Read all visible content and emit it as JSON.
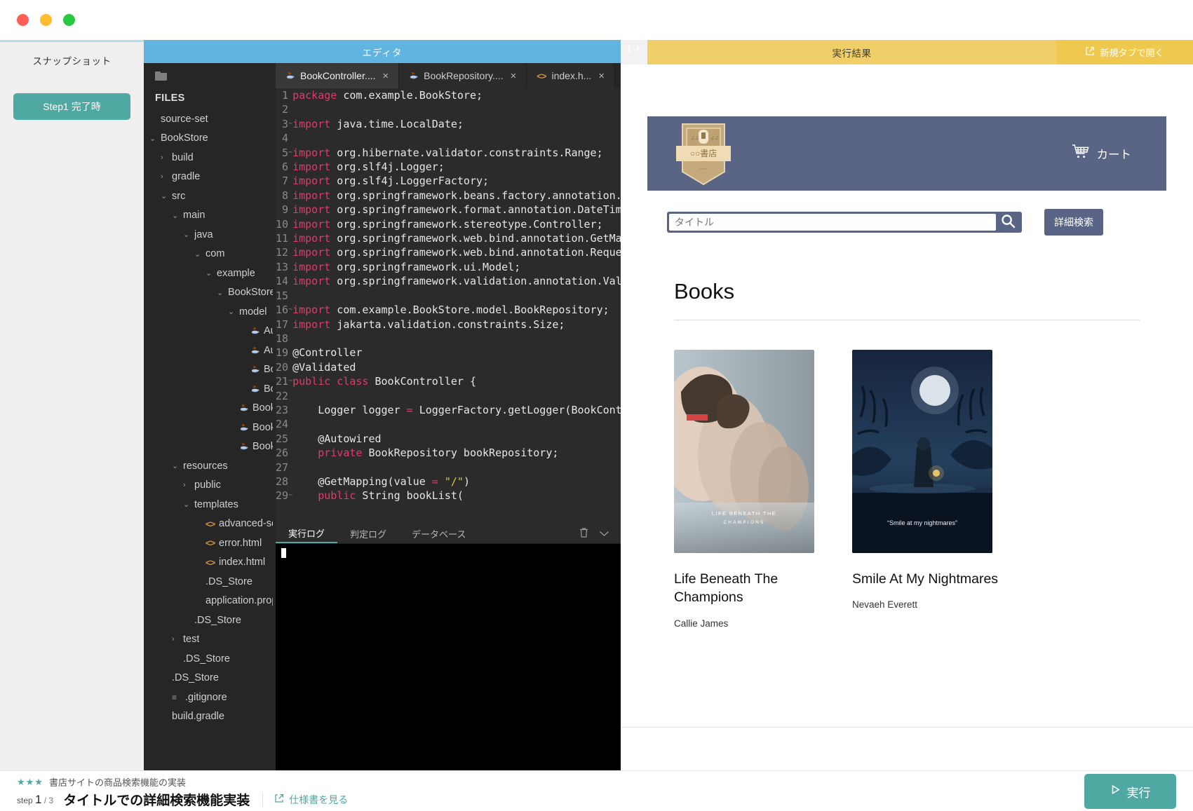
{
  "window": {
    "traffic_lights": [
      "close",
      "minimize",
      "zoom"
    ]
  },
  "snapshot": {
    "title": "スナップショット",
    "button_label": "Step1 完了時"
  },
  "editor": {
    "header_title": "エディタ",
    "filetree_label": "FILES",
    "folder_icon": "folder-icon",
    "items": [
      {
        "label": "source-set",
        "depth": 0,
        "caret": "",
        "icon": ""
      },
      {
        "label": "BookStore",
        "depth": 0,
        "caret": "v",
        "icon": ""
      },
      {
        "label": "build",
        "depth": 1,
        "caret": ">",
        "icon": ""
      },
      {
        "label": "gradle",
        "depth": 1,
        "caret": ">",
        "icon": ""
      },
      {
        "label": "src",
        "depth": 1,
        "caret": "v",
        "icon": ""
      },
      {
        "label": "main",
        "depth": 2,
        "caret": "v",
        "icon": ""
      },
      {
        "label": "java",
        "depth": 3,
        "caret": "v",
        "icon": ""
      },
      {
        "label": "com",
        "depth": 4,
        "caret": "v",
        "icon": ""
      },
      {
        "label": "example",
        "depth": 5,
        "caret": "v",
        "icon": ""
      },
      {
        "label": "BookStore",
        "depth": 6,
        "caret": "v",
        "icon": ""
      },
      {
        "label": "model",
        "depth": 7,
        "caret": "v",
        "icon": ""
      },
      {
        "label": "Author.java",
        "depth": 8,
        "caret": "",
        "icon": "java"
      },
      {
        "label": "AuthorRepository.java",
        "depth": 8,
        "caret": "",
        "icon": "java"
      },
      {
        "label": "Book.java",
        "depth": 8,
        "caret": "",
        "icon": "java"
      },
      {
        "label": "BookRepository.java",
        "depth": 8,
        "caret": "",
        "icon": "java"
      },
      {
        "label": "BookController.java",
        "depth": 7,
        "caret": "",
        "icon": "java"
      },
      {
        "label": "BookStoreApplication.java",
        "depth": 7,
        "caret": "",
        "icon": "java"
      },
      {
        "label": "BookStoreController.java",
        "depth": 7,
        "caret": "",
        "icon": "java"
      },
      {
        "label": "resources",
        "depth": 2,
        "caret": "v",
        "icon": ""
      },
      {
        "label": "public",
        "depth": 3,
        "caret": ">",
        "icon": ""
      },
      {
        "label": "templates",
        "depth": 3,
        "caret": "v",
        "icon": ""
      },
      {
        "label": "advanced-search.html",
        "depth": 4,
        "caret": "",
        "icon": "html"
      },
      {
        "label": "error.html",
        "depth": 4,
        "caret": "",
        "icon": "html"
      },
      {
        "label": "index.html",
        "depth": 4,
        "caret": "",
        "icon": "html"
      },
      {
        "label": ".DS_Store",
        "depth": 4,
        "caret": "",
        "icon": ""
      },
      {
        "label": "application.properties",
        "depth": 4,
        "caret": "",
        "icon": ""
      },
      {
        "label": ".DS_Store",
        "depth": 3,
        "caret": "",
        "icon": ""
      },
      {
        "label": "test",
        "depth": 2,
        "caret": ">",
        "icon": ""
      },
      {
        "label": ".DS_Store",
        "depth": 2,
        "caret": "",
        "icon": ""
      },
      {
        "label": ".DS_Store",
        "depth": 1,
        "caret": "",
        "icon": ""
      },
      {
        "label": ".gitignore",
        "depth": 1,
        "caret": "",
        "icon": "git"
      },
      {
        "label": "build.gradle",
        "depth": 1,
        "caret": "",
        "icon": ""
      }
    ],
    "tabs": [
      {
        "label": "BookController....",
        "icon": "java-icon",
        "active": true,
        "close": "×"
      },
      {
        "label": "BookRepository....",
        "icon": "java-icon",
        "active": false,
        "close": "×"
      },
      {
        "label": "index.h...",
        "icon": "html-icon",
        "active": false,
        "close": "×"
      }
    ],
    "code_lines": [
      {
        "n": 1,
        "fold": "",
        "html": "<span class=\"kw\">package</span> com.example.BookStore;"
      },
      {
        "n": 2,
        "fold": "",
        "html": ""
      },
      {
        "n": 3,
        "fold": "~",
        "html": "<span class=\"kw\">import</span> java.time.LocalDate;"
      },
      {
        "n": 4,
        "fold": "",
        "html": ""
      },
      {
        "n": 5,
        "fold": "~",
        "html": "<span class=\"kw\">import</span> org.hibernate.validator.constraints.Range;"
      },
      {
        "n": 6,
        "fold": "",
        "html": "<span class=\"kw\">import</span> org.slf4j.Logger;"
      },
      {
        "n": 7,
        "fold": "",
        "html": "<span class=\"kw\">import</span> org.slf4j.LoggerFactory;"
      },
      {
        "n": 8,
        "fold": "",
        "html": "<span class=\"kw\">import</span> org.springframework.beans.factory.annotation.Autowired;"
      },
      {
        "n": 9,
        "fold": "",
        "html": "<span class=\"kw\">import</span> org.springframework.format.annotation.DateTimeFormat;"
      },
      {
        "n": 10,
        "fold": "",
        "html": "<span class=\"kw\">import</span> org.springframework.stereotype.Controller;"
      },
      {
        "n": 11,
        "fold": "",
        "html": "<span class=\"kw\">import</span> org.springframework.web.bind.annotation.GetMapping;"
      },
      {
        "n": 12,
        "fold": "",
        "html": "<span class=\"kw\">import</span> org.springframework.web.bind.annotation.RequestParam;"
      },
      {
        "n": 13,
        "fold": "",
        "html": "<span class=\"kw\">import</span> org.springframework.ui.Model;"
      },
      {
        "n": 14,
        "fold": "",
        "html": "<span class=\"kw\">import</span> org.springframework.validation.annotation.Validated;"
      },
      {
        "n": 15,
        "fold": "",
        "html": ""
      },
      {
        "n": 16,
        "fold": "~",
        "html": "<span class=\"kw\">import</span> com.example.BookStore.model.BookRepository;"
      },
      {
        "n": 17,
        "fold": "",
        "html": "<span class=\"kw\">import</span> jakarta.validation.constraints.Size;"
      },
      {
        "n": 18,
        "fold": "",
        "html": ""
      },
      {
        "n": 19,
        "fold": "",
        "html": "@Controller"
      },
      {
        "n": 20,
        "fold": "",
        "html": "@Validated"
      },
      {
        "n": 21,
        "fold": "~",
        "html": "<span class=\"kw\">public class</span> BookController {"
      },
      {
        "n": 22,
        "fold": "",
        "html": ""
      },
      {
        "n": 23,
        "fold": "",
        "html": "    Logger logger <span class=\"op\">=</span> LoggerFactory.getLogger(BookController.class);"
      },
      {
        "n": 24,
        "fold": "",
        "html": ""
      },
      {
        "n": 25,
        "fold": "",
        "html": "    @Autowired"
      },
      {
        "n": 26,
        "fold": "",
        "html": "    <span class=\"kw\">private</span> BookRepository bookRepository;"
      },
      {
        "n": 27,
        "fold": "",
        "html": ""
      },
      {
        "n": 28,
        "fold": "",
        "html": "    @GetMapping(value <span class=\"op\">=</span> <span class=\"str\">\"/\"</span>)"
      },
      {
        "n": 29,
        "fold": "~",
        "html": "    <span class=\"kw\">public</span> String bookList("
      }
    ],
    "console": {
      "tabs": [
        {
          "label": "実行ログ",
          "active": true
        },
        {
          "label": "判定ログ",
          "active": false
        },
        {
          "label": "データベース",
          "active": false
        }
      ],
      "trash_icon": "trash-icon",
      "collapse_icon": "chevron-down-icon",
      "output": ""
    }
  },
  "preview": {
    "reload_icon": "reload-icon",
    "title": "実行結果",
    "new_tab_label": "新規タブで開く",
    "new_tab_icon": "external-link-icon",
    "site": {
      "logo_text": "○○書店",
      "cart_label": "カート",
      "cart_icon": "cart-icon",
      "search_placeholder": "タイトル",
      "search_value": "",
      "search_icon": "search-icon",
      "advanced_search_label": "詳細検索",
      "section_title": "Books",
      "books": [
        {
          "title": "Life Beneath The Champions",
          "author": "Callie James",
          "cover_caption": "LIFE BENEATH THE CHAMPIONS"
        },
        {
          "title": "Smile At My Nightmares",
          "author": "Nevaeh Everett",
          "cover_caption": "“Smile at my nightmares”"
        }
      ]
    }
  },
  "footer": {
    "stars": "★★★",
    "task_subtitle": "書店サイトの商品検索機能の実装",
    "step_prefix": "step",
    "step_current": "1",
    "step_total": "/ 3",
    "task_title": "タイトルでの詳細検索機能実装",
    "spec_link_label": "仕様書を見る",
    "spec_link_icon": "external-link-icon",
    "run_label": "実行",
    "run_icon": "play-icon"
  },
  "colors": {
    "accent_teal": "#4fa8a1",
    "editor_header_blue": "#61b3e0",
    "preview_header_yellow": "#f0cf68",
    "site_navy": "#5a6484"
  }
}
